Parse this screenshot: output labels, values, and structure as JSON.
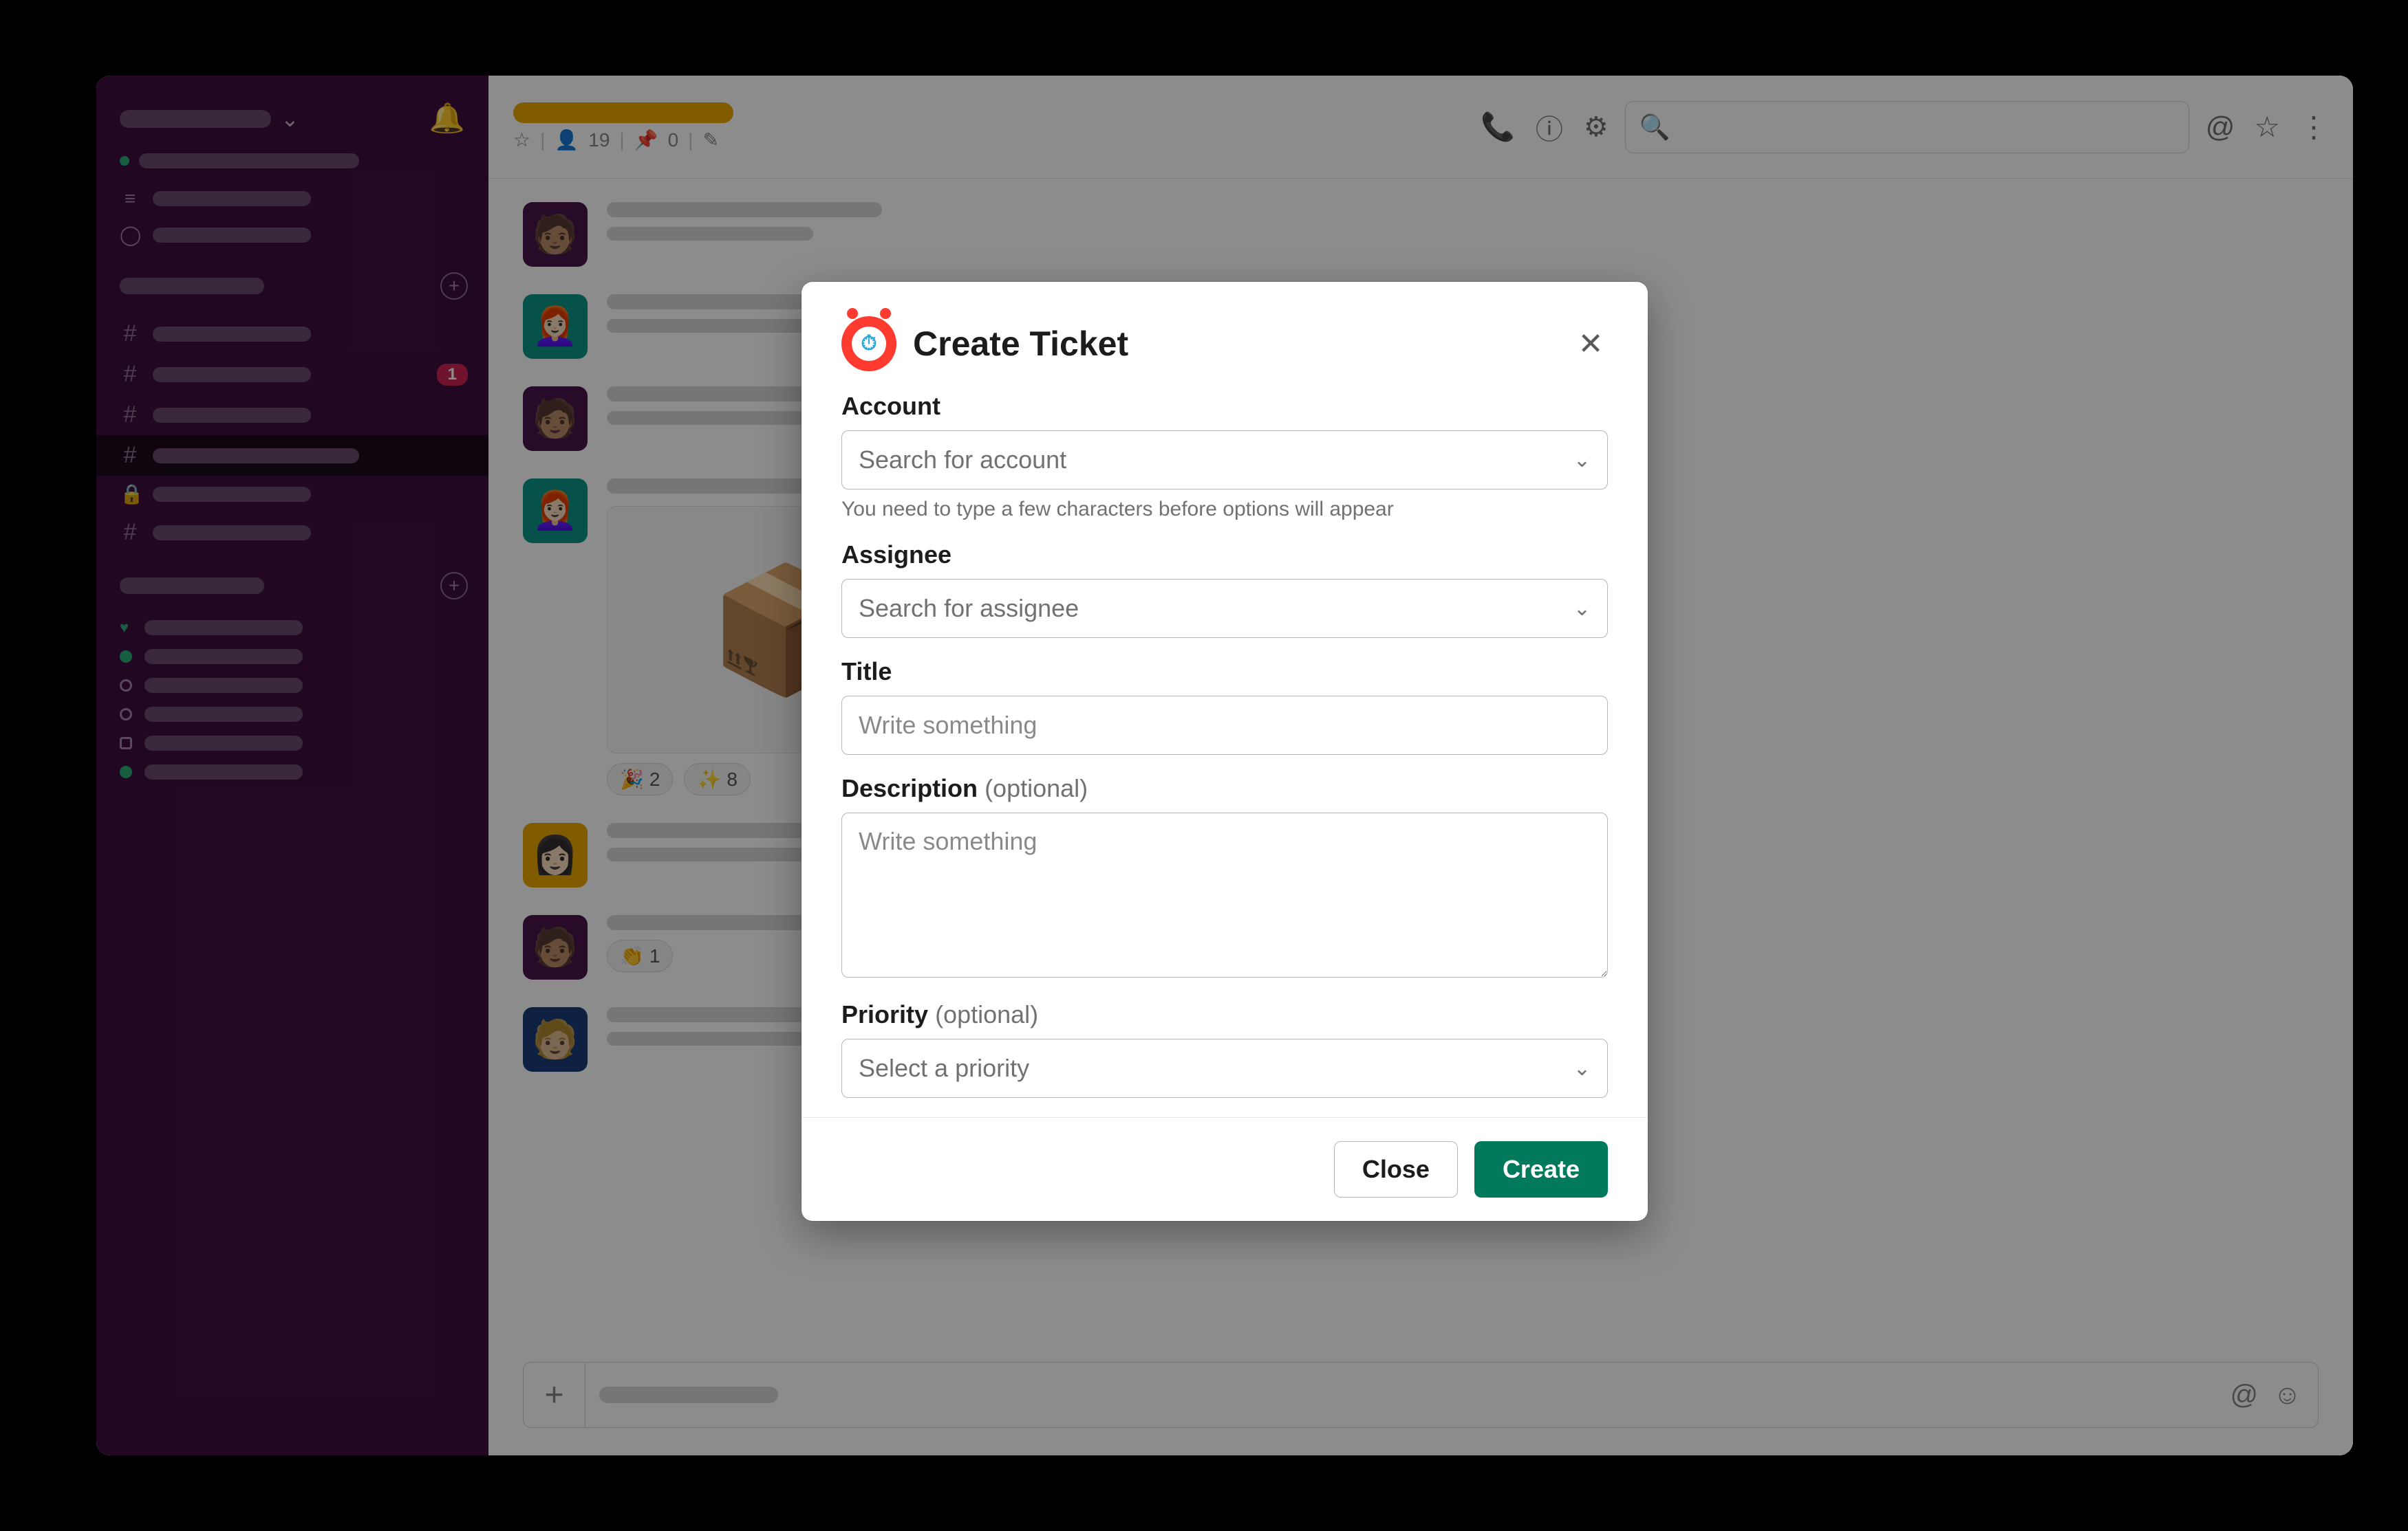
{
  "header": {
    "member_count": "19",
    "pin_count": "0"
  },
  "sidebar": {
    "badge_count": "1"
  },
  "reactions": {
    "r1_count": "2",
    "r2_count": "8",
    "r3_count": "1"
  },
  "modal": {
    "title": "Create Ticket",
    "account": {
      "label": "Account",
      "placeholder": "Search for account",
      "hint": "You need to type a few characters before options will appear"
    },
    "assignee": {
      "label": "Assignee",
      "placeholder": "Search for assignee"
    },
    "title_field": {
      "label": "Title",
      "placeholder": "Write something"
    },
    "description": {
      "label": "Description",
      "optional": "(optional)",
      "placeholder": "Write something"
    },
    "priority": {
      "label": "Priority",
      "optional": "(optional)",
      "placeholder": "Select a priority"
    },
    "buttons": {
      "close": "Close",
      "create": "Create"
    }
  }
}
